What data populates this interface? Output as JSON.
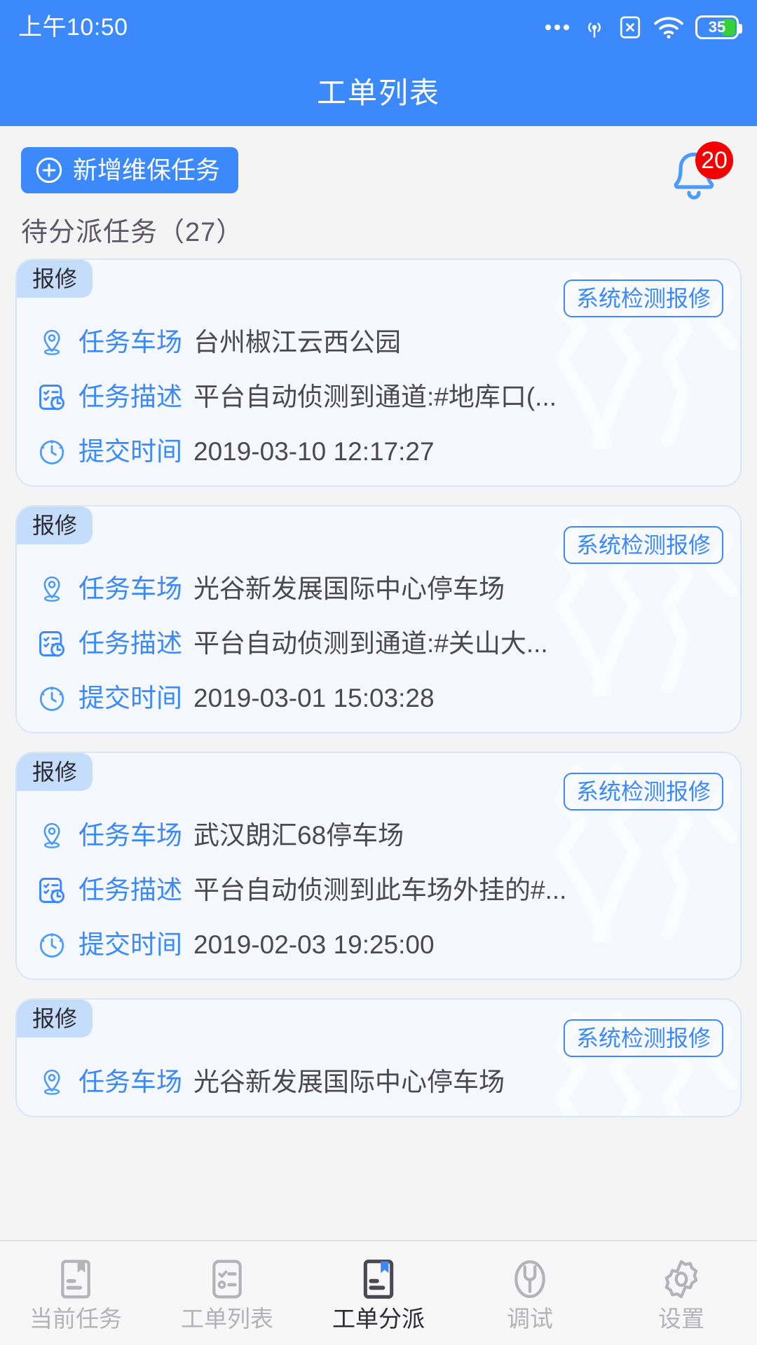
{
  "status_bar": {
    "time": "上午10:50",
    "battery_level": "35",
    "icons": [
      "more-dots-icon",
      "nfc-icon",
      "sim-x-icon",
      "wifi-icon",
      "battery-icon"
    ]
  },
  "app_bar": {
    "title": "工单列表"
  },
  "toolbar": {
    "add_task_label": "新增维保任务",
    "add_icon": "plus-circle-icon",
    "notification_icon": "bell-icon",
    "notification_count": "20"
  },
  "section": {
    "title": "待分派任务（27）"
  },
  "labels": {
    "site": "任务车场",
    "description": "任务描述",
    "submit_time": "提交时间"
  },
  "colors": {
    "brand": "#3b89fb",
    "card_bg": "#f5f9ff",
    "card_border": "#d7e6fb",
    "badge_type_bg": "#c6dcfb",
    "badge_red": "#f40000",
    "page_bg": "#f4f4f4",
    "text_dark": "#4b4854",
    "tab_inactive": "#b3b3b8"
  },
  "cards": [
    {
      "type_badge": "报修",
      "source_badge": "系统检测报修",
      "site": "台州椒江云西公园",
      "description": "平台自动侦测到通道:#地库口(...",
      "submit_time": "2019-03-10 12:17:27"
    },
    {
      "type_badge": "报修",
      "source_badge": "系统检测报修",
      "site": "光谷新发展国际中心停车场",
      "description": "平台自动侦测到通道:#关山大...",
      "submit_time": "2019-03-01 15:03:28"
    },
    {
      "type_badge": "报修",
      "source_badge": "系统检测报修",
      "site": "武汉朗汇68停车场",
      "description": "平台自动侦测到此车场外挂的#...",
      "submit_time": "2019-02-03 19:25:00"
    },
    {
      "type_badge": "报修",
      "source_badge": "系统检测报修",
      "site": "光谷新发展国际中心停车场",
      "description": "",
      "submit_time": ""
    }
  ],
  "tab_bar": {
    "items": [
      {
        "label": "当前任务",
        "icon": "document-bookmark-icon",
        "active": false
      },
      {
        "label": "工单列表",
        "icon": "checklist-icon",
        "active": false
      },
      {
        "label": "工单分派",
        "icon": "document-bookmark-filled-icon",
        "active": true
      },
      {
        "label": "调试",
        "icon": "wrench-icon",
        "active": false
      },
      {
        "label": "设置",
        "icon": "gear-icon",
        "active": false
      }
    ]
  }
}
